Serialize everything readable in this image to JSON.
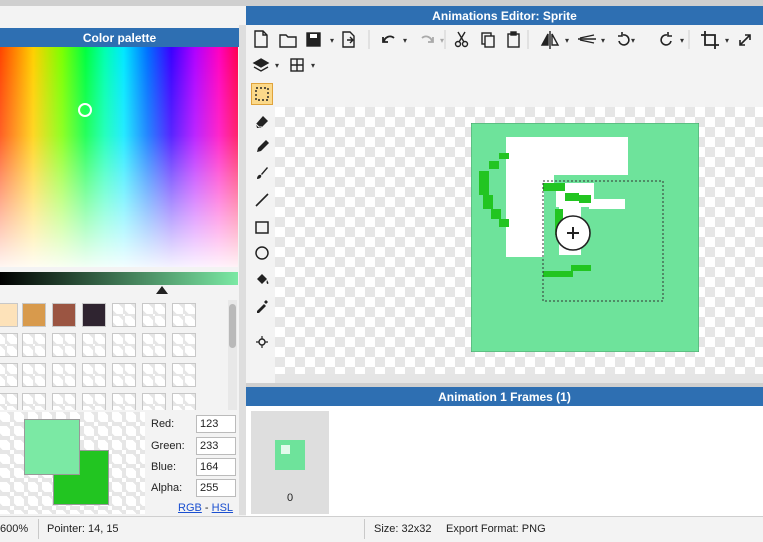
{
  "window": {
    "title": "Animations Editor: Sprite"
  },
  "palette": {
    "title": "Color palette",
    "swatches": [
      "#fde2b9",
      "#d89a4c",
      "#9b5542",
      "#2f2430"
    ]
  },
  "color_values": {
    "red_label": "Red:",
    "red": "123",
    "green_label": "Green:",
    "green": "233",
    "blue_label": "Blue:",
    "blue": "164",
    "alpha_label": "Alpha:",
    "alpha": "255",
    "rgb_link": "RGB",
    "link_sep": "-",
    "hsl_link": "HSL",
    "primary_color": "#7be9a4",
    "secondary_color": "#22c521"
  },
  "frames": {
    "title": "Animation 1 Frames (1)",
    "items": [
      {
        "label": "0"
      }
    ]
  },
  "status": {
    "zoom": "600%",
    "pointer": "Pointer: 14, 15",
    "size": "Size: 32x32",
    "format": "Export Format: PNG"
  },
  "toolbar": {
    "icons": [
      "new-file-icon",
      "open-folder-icon",
      "save-icon",
      "export-icon",
      "undo-icon",
      "redo-icon",
      "cut-icon",
      "copy-icon",
      "paste-icon",
      "flip-horizontal-icon",
      "flip-vertical-icon",
      "rotate-left-icon",
      "rotate-right-icon",
      "crop-icon",
      "resize-icon",
      "layers-icon",
      "grid-icon"
    ]
  },
  "tools": [
    "select-rect-icon",
    "eraser-icon",
    "pencil-icon",
    "brush-icon",
    "line-icon",
    "rectangle-icon",
    "ellipse-icon",
    "fill-bucket-icon",
    "eyedropper-icon",
    "pivot-icon"
  ]
}
